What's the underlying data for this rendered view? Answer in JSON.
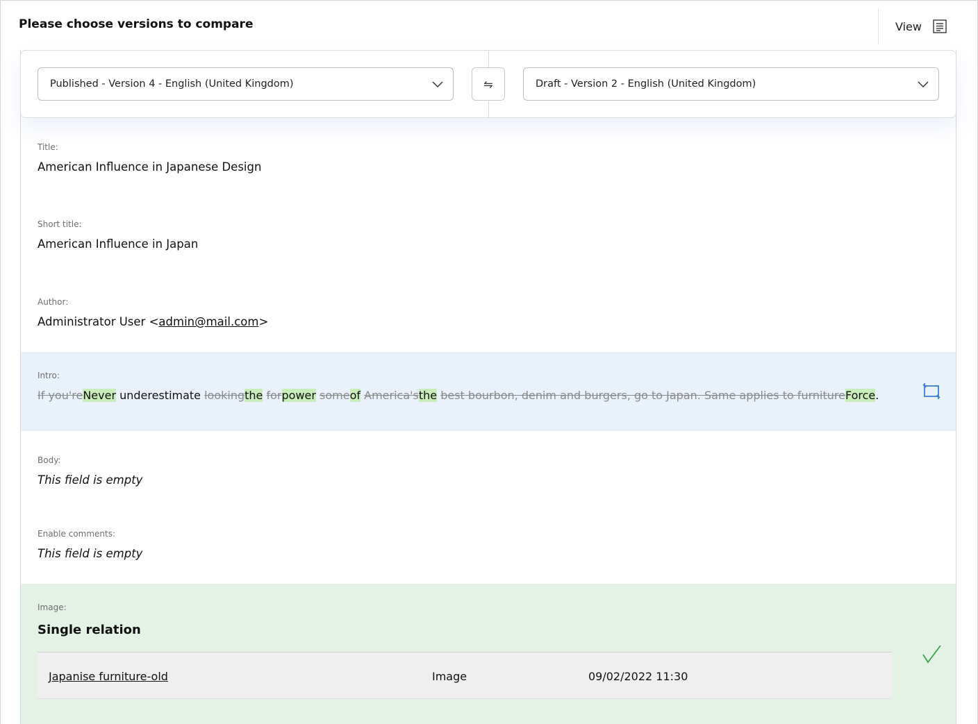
{
  "header": {
    "title": "Please choose versions to compare",
    "view_label": "View",
    "view_icon": "document-lines-icon"
  },
  "selector": {
    "left_version": "Published - Version 4 - English (United Kingdom)",
    "right_version": "Draft - Version 2 - English (United Kingdom)",
    "swap_symbol": "⇋"
  },
  "fields": {
    "title": {
      "label": "Title:",
      "value": "American Influence in Japanese Design"
    },
    "short_title": {
      "label": "Short title:",
      "value": "American Influence in Japan"
    },
    "author": {
      "label": "Author:",
      "prefix": "Administrator User <",
      "email": "admin@mail.com",
      "suffix": ">"
    },
    "intro": {
      "label": "Intro:",
      "diff": [
        {
          "type": "del",
          "text": "If you're"
        },
        {
          "type": "ins",
          "text": "Never"
        },
        {
          "type": "same",
          "text": " underestimate "
        },
        {
          "type": "del",
          "text": "looking"
        },
        {
          "type": "ins",
          "text": "the"
        },
        {
          "type": "same",
          "text": " "
        },
        {
          "type": "del",
          "text": "for"
        },
        {
          "type": "ins",
          "text": "power"
        },
        {
          "type": "same",
          "text": " "
        },
        {
          "type": "del",
          "text": "some"
        },
        {
          "type": "ins",
          "text": "of"
        },
        {
          "type": "same",
          "text": " "
        },
        {
          "type": "del",
          "text": "America's"
        },
        {
          "type": "ins",
          "text": "the"
        },
        {
          "type": "same",
          "text": " "
        },
        {
          "type": "del",
          "text": "best bourbon, denim and burgers, go to Japan. Same applies to furniture"
        },
        {
          "type": "ins",
          "text": "Force"
        },
        {
          "type": "same",
          "text": "."
        }
      ],
      "status_icon": "revert-icon",
      "highlight_color": "#e9f1fb"
    },
    "body": {
      "label": "Body:",
      "value": "This field is empty"
    },
    "enable_comments": {
      "label": "Enable comments:",
      "value": "This field is empty"
    },
    "image": {
      "label": "Image:",
      "relation_title": "Single relation",
      "item_name": "Japanise furniture-old",
      "item_type": "Image",
      "item_date": "09/02/2022 11:30",
      "status_icon": "checkmark-icon",
      "highlight_color": "#e4f2e5"
    }
  }
}
